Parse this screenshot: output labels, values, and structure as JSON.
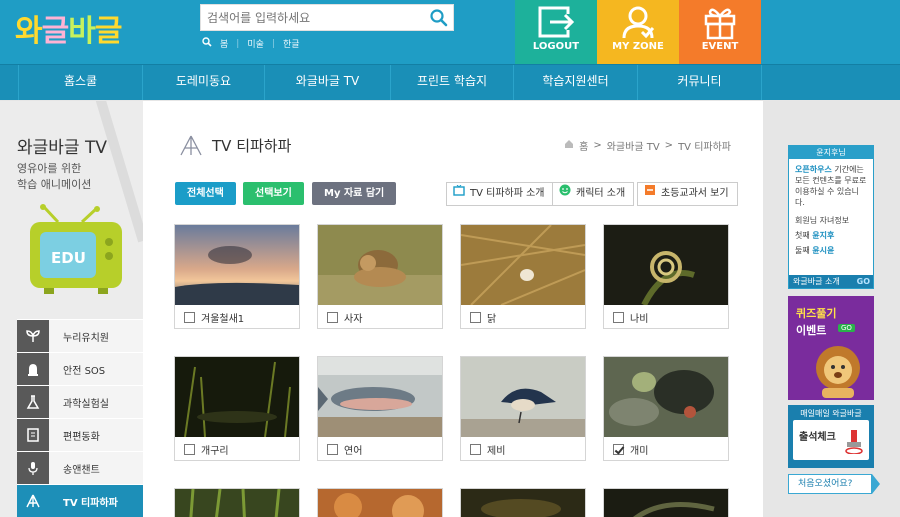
{
  "header": {
    "logo_chars": [
      "와",
      "글",
      "바",
      "글"
    ],
    "logo_colors": [
      "#ffd92e",
      "#ffd92e",
      "#ffd92e",
      "#ffd92e"
    ],
    "search_placeholder": "검색어를 입력하세요",
    "search_links": [
      "봄",
      "미술",
      "한글"
    ],
    "buttons": {
      "logout": "LOGOUT",
      "myzone": "MY ZONE",
      "event": "EVENT"
    }
  },
  "gnb": [
    "홈스쿨",
    "도레미동요",
    "와글바글 TV",
    "프린트 학습지",
    "학습지원센터",
    "커뮤니티"
  ],
  "lnb": {
    "title": "와글바글 TV",
    "desc_line1": "영유아를 위한",
    "desc_line2": "학습 애니메이션",
    "tv_label": "EDU",
    "menu": [
      "누리유치원",
      "안전 SOS",
      "과학실험실",
      "편편동화",
      "송앤챈트",
      "TV 티파하파"
    ]
  },
  "content": {
    "title": "TV 티파하파",
    "breadcrumb": [
      "홈",
      ">",
      "와글바글 TV",
      ">",
      "TV 티파하파"
    ],
    "buttons": {
      "select_all": "전체선택",
      "view_selected": "선택보기",
      "add_my": "My 자료 담기"
    },
    "info_buttons": [
      "TV 티파하파 소개",
      "캐릭터 소개",
      "초등교과서 보기"
    ],
    "items": [
      {
        "label": "겨울철새1",
        "checked": false
      },
      {
        "label": "사자",
        "checked": false
      },
      {
        "label": "닭",
        "checked": false
      },
      {
        "label": "나비",
        "checked": false
      },
      {
        "label": "개구리",
        "checked": false
      },
      {
        "label": "연어",
        "checked": false
      },
      {
        "label": "제비",
        "checked": false
      },
      {
        "label": "개미",
        "checked": true
      }
    ]
  },
  "right": {
    "login_top": "윤지후님",
    "login_msg_b": "오픈하우스",
    "login_msg": " 기간에는 모든 컨텐츠를 무료로 이용하실 수 있습니다.",
    "login_line1": "회원님 자녀정보",
    "child1_label": "첫째",
    "child1": "윤지후",
    "child2_label": "둘째",
    "child2": "윤시윤",
    "intro": "와글바글 소개",
    "go": "GO",
    "quiz_line1": "퀴즈풀기",
    "quiz_line2": "이벤트",
    "quiz_go": "GO",
    "check_title": "매일매일 와글바글",
    "check_card": "출석체크",
    "came": "처음오셨어요?"
  },
  "colors": {
    "header": "#1f9dc5",
    "gnb": "#1a8fb7",
    "logout": "#1db19b",
    "myzone": "#f5b720",
    "event": "#f47b2a",
    "select_all": "#1b9dc8",
    "view_selected": "#2bbf6e",
    "add_my": "#6d7280"
  }
}
